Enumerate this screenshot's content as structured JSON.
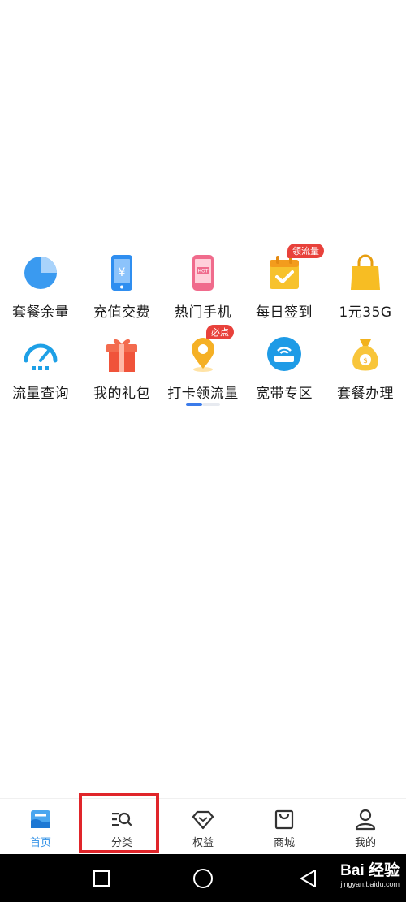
{
  "grid": {
    "items": [
      {
        "label": "套餐余量",
        "icon": "pie-chart-icon"
      },
      {
        "label": "充值交费",
        "icon": "phone-yuan-icon"
      },
      {
        "label": "热门手机",
        "icon": "hot-phone-icon"
      },
      {
        "label": "每日签到",
        "icon": "calendar-check-icon",
        "badge": "领流量"
      },
      {
        "label": "1元35G",
        "icon": "shopping-bag-icon"
      },
      {
        "label": "流量查询",
        "icon": "speedometer-icon"
      },
      {
        "label": "我的礼包",
        "icon": "gift-icon"
      },
      {
        "label": "打卡领流量",
        "icon": "location-pin-icon",
        "badge": "必点"
      },
      {
        "label": "宽带专区",
        "icon": "router-icon"
      },
      {
        "label": "套餐办理",
        "icon": "money-bag-icon"
      }
    ]
  },
  "tabbar": {
    "tabs": [
      {
        "label": "首页",
        "icon": "home-icon",
        "active": true
      },
      {
        "label": "分类",
        "icon": "category-search-icon",
        "active": false
      },
      {
        "label": "权益",
        "icon": "diamond-icon",
        "active": false
      },
      {
        "label": "商城",
        "icon": "shopping-bag-outline-icon",
        "active": false
      },
      {
        "label": "我的",
        "icon": "user-icon",
        "active": false
      }
    ]
  },
  "watermark": {
    "brand": "Bai 经验",
    "url": "jingyan.baidu.com"
  },
  "colors": {
    "accent": "#2e8fe6",
    "badge": "#e8413b",
    "highlight": "#e0252a",
    "pager": "#3b7bea"
  }
}
